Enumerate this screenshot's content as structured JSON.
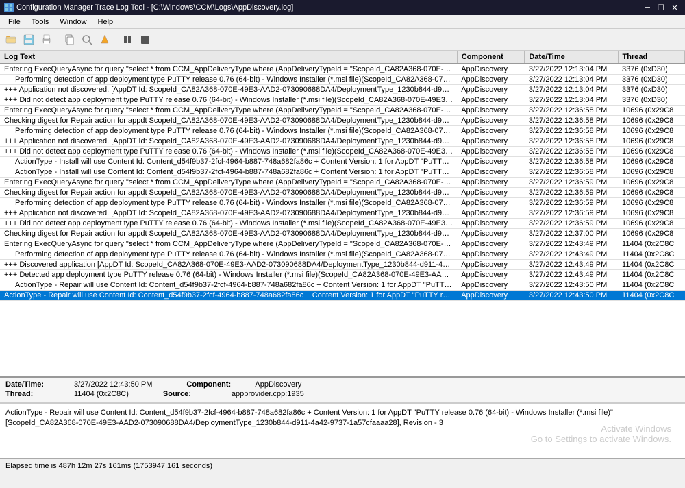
{
  "titleBar": {
    "title": "Configuration Manager Trace Log Tool - [C:\\Windows\\CCM\\Logs\\AppDiscovery.log]",
    "iconLabel": "CM",
    "minBtn": "─",
    "maxBtn": "□",
    "closeBtn": "✕",
    "restoreBtn": "❐"
  },
  "menuBar": {
    "items": [
      "File",
      "Tools",
      "Window",
      "Help"
    ]
  },
  "toolbar": {
    "icons": [
      "📂",
      "💾",
      "🖨",
      "📋",
      "🔍",
      "✏",
      "⏸",
      "🔲"
    ]
  },
  "tableHeaders": {
    "logText": "Log Text",
    "component": "Component",
    "dateTime": "Date/Time",
    "thread": "Thread"
  },
  "logRows": [
    {
      "text": "Entering ExecQueryAsync for query \"select * from CCM_AppDeliveryType where (AppDeliveryTypeId = \"ScopeId_CA82A368-070E-49...",
      "component": "AppDiscovery",
      "dateTime": "3/27/2022 12:13:04 PM",
      "thread": "3376 (0xD30)",
      "indent": 0
    },
    {
      "text": "    Performing detection of app deployment type PuTTY release 0.76 (64-bit) - Windows Installer (*.msi file)(ScopeId_CA82A368-070E...",
      "component": "AppDiscovery",
      "dateTime": "3/27/2022 12:13:04 PM",
      "thread": "3376 (0xD30)",
      "indent": 1
    },
    {
      "text": "+++ Application not discovered. [AppDT Id: ScopeId_CA82A368-070E-49E3-AAD2-073090688DA4/DeploymentType_1230b844-d911-...",
      "component": "AppDiscovery",
      "dateTime": "3/27/2022 12:13:04 PM",
      "thread": "3376 (0xD30)",
      "indent": 0
    },
    {
      "text": "+++ Did not detect app deployment type PuTTY release 0.76 (64-bit) - Windows Installer (*.msi file)(ScopeId_CA82A368-070E-49E3-...",
      "component": "AppDiscovery",
      "dateTime": "3/27/2022 12:13:04 PM",
      "thread": "3376 (0xD30)",
      "indent": 0
    },
    {
      "text": "Entering ExecQueryAsync for query \"select * from CCM_AppDeliveryType where (AppDeliveryTypeId = \"ScopeId_CA82A368-070E-49...",
      "component": "AppDiscovery",
      "dateTime": "3/27/2022 12:36:58 PM",
      "thread": "10696 (0x29C8",
      "indent": 0
    },
    {
      "text": "Checking digest for Repair action for appdt ScopeId_CA82A368-070E-49E3-AAD2-073090688DA4/DeploymentType_1230b844-d911-4...",
      "component": "AppDiscovery",
      "dateTime": "3/27/2022 12:36:58 PM",
      "thread": "10696 (0x29C8",
      "indent": 0
    },
    {
      "text": "    Performing detection of app deployment type PuTTY release 0.76 (64-bit) - Windows Installer (*.msi file)(ScopeId_CA82A368-070E...",
      "component": "AppDiscovery",
      "dateTime": "3/27/2022 12:36:58 PM",
      "thread": "10696 (0x29C8",
      "indent": 1
    },
    {
      "text": "+++ Application not discovered. [AppDT Id: ScopeId_CA82A368-070E-49E3-AAD2-073090688DA4/DeploymentType_1230b844-d911-...",
      "component": "AppDiscovery",
      "dateTime": "3/27/2022 12:36:58 PM",
      "thread": "10696 (0x29C8",
      "indent": 0
    },
    {
      "text": "+++ Did not detect app deployment type PuTTY release 0.76 (64-bit) - Windows Installer (*.msi file)(ScopeId_CA82A368-070E-49E3-...",
      "component": "AppDiscovery",
      "dateTime": "3/27/2022 12:36:58 PM",
      "thread": "10696 (0x29C8",
      "indent": 0
    },
    {
      "text": "    ActionType - Install will use Content Id: Content_d54f9b37-2fcf-4964-b887-748a682fa86c + Content Version: 1 for AppDT \"PuTTY rel...",
      "component": "AppDiscovery",
      "dateTime": "3/27/2022 12:36:58 PM",
      "thread": "10696 (0x29C8",
      "indent": 1
    },
    {
      "text": "    ActionType - Install will use Content Id: Content_d54f9b37-2fcf-4964-b887-748a682fa86c + Content Version: 1 for AppDT \"PuTTY rel...",
      "component": "AppDiscovery",
      "dateTime": "3/27/2022 12:36:58 PM",
      "thread": "10696 (0x29C8",
      "indent": 1
    },
    {
      "text": "Entering ExecQueryAsync for query \"select * from CCM_AppDeliveryType where (AppDeliveryTypeId = \"ScopeId_CA82A368-070E-49...",
      "component": "AppDiscovery",
      "dateTime": "3/27/2022 12:36:59 PM",
      "thread": "10696 (0x29C8",
      "indent": 0
    },
    {
      "text": "Checking digest for Repair action for appdt ScopeId_CA82A368-070E-49E3-AAD2-073090688DA4/DeploymentType_1230b844-d911-4...",
      "component": "AppDiscovery",
      "dateTime": "3/27/2022 12:36:59 PM",
      "thread": "10696 (0x29C8",
      "indent": 0
    },
    {
      "text": "    Performing detection of app deployment type PuTTY release 0.76 (64-bit) - Windows Installer (*.msi file)(ScopeId_CA82A368-070E...",
      "component": "AppDiscovery",
      "dateTime": "3/27/2022 12:36:59 PM",
      "thread": "10696 (0x29C8",
      "indent": 1
    },
    {
      "text": "+++ Application not discovered. [AppDT Id: ScopeId_CA82A368-070E-49E3-AAD2-073090688DA4/DeploymentType_1230b844-d911-...",
      "component": "AppDiscovery",
      "dateTime": "3/27/2022 12:36:59 PM",
      "thread": "10696 (0x29C8",
      "indent": 0
    },
    {
      "text": "+++ Did not detect app deployment type PuTTY release 0.76 (64-bit) - Windows Installer (*.msi file)(ScopeId_CA82A368-070E-49E3-...",
      "component": "AppDiscovery",
      "dateTime": "3/27/2022 12:36:59 PM",
      "thread": "10696 (0x29C8",
      "indent": 0
    },
    {
      "text": "Checking digest for Repair action for appdt ScopeId_CA82A368-070E-49E3-AAD2-073090688DA4/DeploymentType_1230b844-d911-4...",
      "component": "AppDiscovery",
      "dateTime": "3/27/2022 12:37:00 PM",
      "thread": "10696 (0x29C8",
      "indent": 0
    },
    {
      "text": "Entering ExecQueryAsync for query \"select * from CCM_AppDeliveryType where (AppDeliveryTypeId = \"ScopeId_CA82A368-070E-49...",
      "component": "AppDiscovery",
      "dateTime": "3/27/2022 12:43:49 PM",
      "thread": "11404 (0x2C8C",
      "indent": 0
    },
    {
      "text": "    Performing detection of app deployment type PuTTY release 0.76 (64-bit) - Windows Installer (*.msi file)(ScopeId_CA82A368-070E...",
      "component": "AppDiscovery",
      "dateTime": "3/27/2022 12:43:49 PM",
      "thread": "11404 (0x2C8C",
      "indent": 1
    },
    {
      "text": "+++ Discovered application [AppDT Id: ScopeId_CA82A368-070E-49E3-AAD2-073090688DA4/DeploymentType_1230b844-d911-4a42-...",
      "component": "AppDiscovery",
      "dateTime": "3/27/2022 12:43:49 PM",
      "thread": "11404 (0x2C8C",
      "indent": 0
    },
    {
      "text": "+++ Detected app deployment type PuTTY release 0.76 (64-bit) - Windows Installer (*.msi file)(ScopeId_CA82A368-070E-49E3-AAD2-...",
      "component": "AppDiscovery",
      "dateTime": "3/27/2022 12:43:49 PM",
      "thread": "11404 (0x2C8C",
      "indent": 0
    },
    {
      "text": "    ActionType - Repair will use Content Id: Content_d54f9b37-2fcf-4964-b887-748a682fa86c + Content Version: 1 for AppDT \"PuTTY re...",
      "component": "AppDiscovery",
      "dateTime": "3/27/2022 12:43:50 PM",
      "thread": "11404 (0x2C8C",
      "indent": 1
    },
    {
      "text": "ActionType - Repair will use Content Id: Content_d54f9b37-2fcf-4964-b887-748a682fa86c + Content Version: 1 for AppDT \"PuTTY re...",
      "component": "AppDiscovery",
      "dateTime": "3/27/2022 12:43:50 PM",
      "thread": "11404 (0x2C8C",
      "indent": 0,
      "selected": true
    }
  ],
  "detailPanel": {
    "dateTimeLabel": "Date/Time:",
    "dateTimeValue": "3/27/2022 12:43:50 PM",
    "componentLabel": "Component:",
    "componentValue": "AppDiscovery",
    "threadLabel": "Thread:",
    "threadValue": "11404 (0x2C8C)",
    "sourceLabel": "Source:",
    "sourceValue": "appprovider.cpp:1935"
  },
  "messagePanel": {
    "text": "ActionType - Repair will use Content Id: Content_d54f9b37-2fcf-4964-b887-748a682fa86c + Content Version: 1 for AppDT \"PuTTY release 0.76 (64-bit) - Windows Installer (*.msi file)\"\n[ScopeId_CA82A368-070E-49E3-AAD2-073090688DA4/DeploymentType_1230b844-d911-4a42-9737-1a57cfaaaa28], Revision - 3",
    "watermark1": "Activate Windows",
    "watermark2": "Go to Settings to activate Windows."
  },
  "statusBar": {
    "text": "Elapsed time is 487h 12m 27s 161ms (1753947.161 seconds)"
  }
}
